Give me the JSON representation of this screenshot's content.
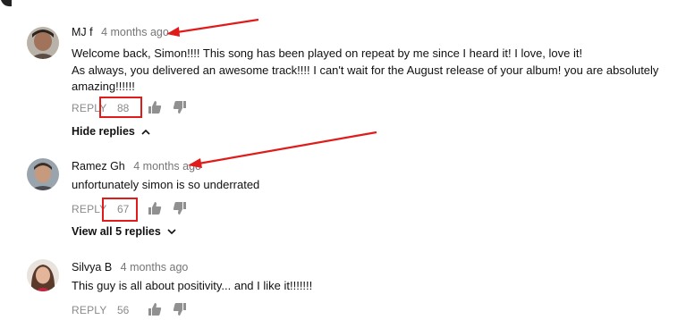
{
  "comments": [
    {
      "author": "MJ f",
      "time": "4 months ago",
      "lines": [
        "Welcome back, Simon!!!! This song has been played on repeat by me since I heard it! I love, love it!",
        "As always, you delivered an awesome track!!!! I can't wait for the August release of your album! you are absolutely",
        "amazing!!!!!!"
      ],
      "reply_label": "REPLY",
      "likes": "88"
    },
    {
      "author": "Ramez Gh",
      "time": "4 months ago",
      "lines": [
        "unfortunately simon is so underrated"
      ],
      "reply_label": "REPLY",
      "likes": "67"
    },
    {
      "author": "Silvya B",
      "time": "4 months ago",
      "lines": [
        "This guy is all about positivity... and I like it!!!!!!!"
      ],
      "reply_label": "REPLY",
      "likes": "56"
    }
  ],
  "threads": {
    "hide_replies": "Hide replies",
    "view_all": "View all 5 replies"
  },
  "colors": {
    "annotation": "#e11a1a",
    "meta_text": "#767676",
    "action_text": "#8a8a8a",
    "icon": "#909090"
  },
  "icons": [
    "thumbs-up-icon",
    "thumbs-down-icon",
    "chevron-up-icon",
    "chevron-down-icon"
  ]
}
